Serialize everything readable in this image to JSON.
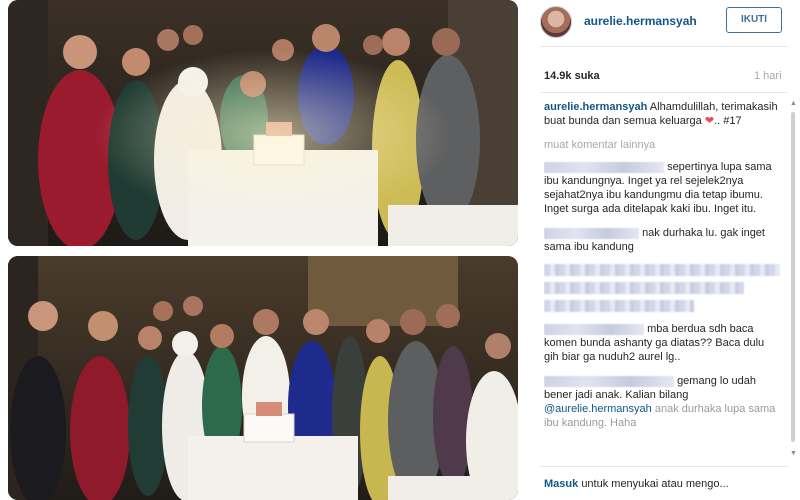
{
  "post": {
    "username": "aurelie.hermansyah",
    "follow_label": "IKUTI",
    "likes": "14.9k suka",
    "time_ago": "1 hari"
  },
  "caption": {
    "username": "aurelie.hermansyah",
    "text": "Alhamdulillah, terimakasih buat bunda dan semua keluarga",
    "heart": "❤",
    "tail": ".. #17"
  },
  "more_comments_label": "muat komentar lainnya",
  "comments": [
    {
      "text": "sepertinya lupa sama ibu kandungnya. Inget ya rel sejelek2nya sejahat2nya ibu kandungmu dia tetap ibumu. Inget surga ada ditelapak kaki ibu. Inget itu."
    },
    {
      "text": "nak durhaka lu. gak inget sama ibu kandung"
    },
    {
      "text": "mba berdua sdh baca komen bunda ashanty ga diatas?? Baca dulu gih biar ga nuduh2 aurel lg.."
    },
    {
      "text_before": "gemang lo udah bener jadi anak. Kalian bilang",
      "mention": "@aurelie.hermansyah",
      "text_after": "anak durhaka lupa sama ibu kandung. Haha"
    }
  ],
  "footer": {
    "login": "Masuk",
    "text": "untuk menyukai atau mengo..."
  },
  "colors": {
    "link_blue": "#125688",
    "follow_border": "#3f729b",
    "muted_gray": "#a5a7aa",
    "heart_red": "#ed4956"
  }
}
